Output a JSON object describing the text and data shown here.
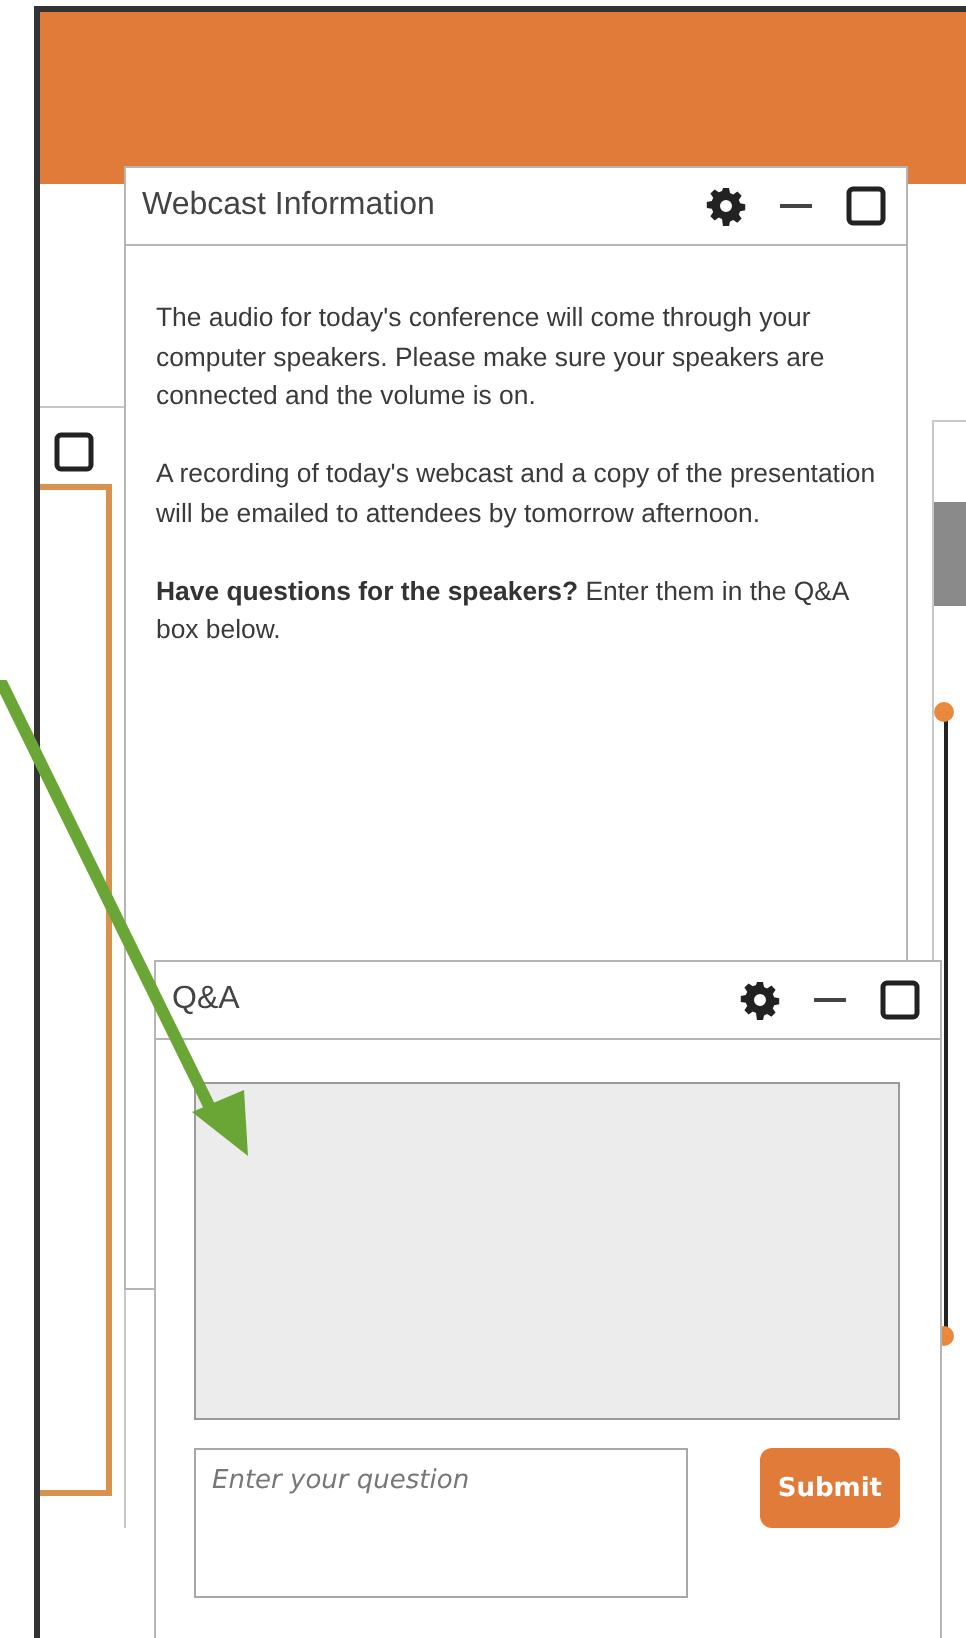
{
  "info_window": {
    "title": "Webcast Information",
    "paragraphs": [
      "The audio for today's conference will come through your computer speakers. Please make sure your speakers are connected and the volume is on.",
      "A recording of today's webcast and a copy of the presentation will be emailed to attendees by tomorrow afternoon.",
      "**Have questions for the speakers?** Enter them in the Q&A box below."
    ]
  },
  "qa_window": {
    "title": "Q&A",
    "question_field": {
      "placeholder": "Enter your question"
    },
    "submit_button": "Submit"
  }
}
